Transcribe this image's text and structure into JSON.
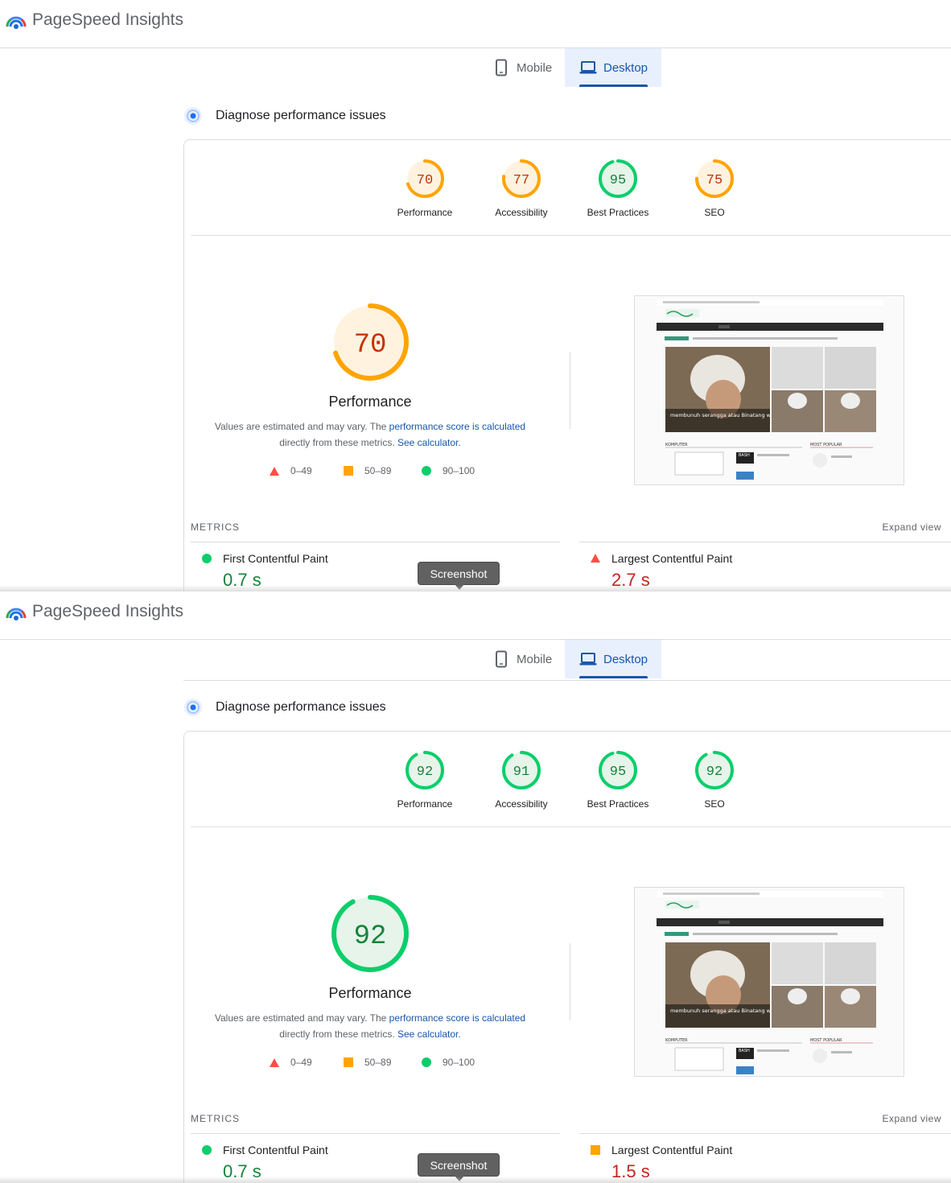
{
  "app": {
    "title": "PageSpeed Insights"
  },
  "tabs": {
    "mobile": "Mobile",
    "desktop": "Desktop"
  },
  "diagnose_title": "Diagnose performance issues",
  "labels": {
    "performance": "Performance",
    "accessibility": "Accessibility",
    "best_practices": "Best Practices",
    "seo": "SEO"
  },
  "description": {
    "pre": "Values are estimated and may vary. The ",
    "link1": "performance score is calculated",
    "mid": "directly from these metrics. ",
    "link2": "See calculator."
  },
  "legend": {
    "poor": "0–49",
    "avg": "50–89",
    "good": "90–100"
  },
  "metrics_header": "METRICS",
  "expand_view": "Expand view",
  "tooltip": "Screenshot",
  "colors": {
    "good": "#0cce6b",
    "average": "#ffa400",
    "poor": "#ff4e42",
    "accent": "#1a56a8"
  },
  "panels": [
    {
      "scores": {
        "performance": "70",
        "accessibility": "77",
        "best_practices": "95",
        "seo": "75"
      },
      "metrics": {
        "fcp_name": "First Contentful Paint",
        "fcp_value": "0.7 s",
        "lcp_name": "Largest Contentful Paint",
        "lcp_value": "2.7 s"
      }
    },
    {
      "scores": {
        "performance": "92",
        "accessibility": "91",
        "best_practices": "95",
        "seo": "92"
      },
      "metrics": {
        "fcp_name": "First Contentful Paint",
        "fcp_value": "0.7 s",
        "lcp_name": "Largest Contentful Paint",
        "lcp_value": "1.5 s"
      }
    }
  ],
  "site_preview": {
    "caption": "membunuh serangga atau Binatang waktu puasa batal tidak?",
    "section_left": "KOMPUTER",
    "section_right": "MOST POPULAR",
    "bash_label": "BASH"
  }
}
